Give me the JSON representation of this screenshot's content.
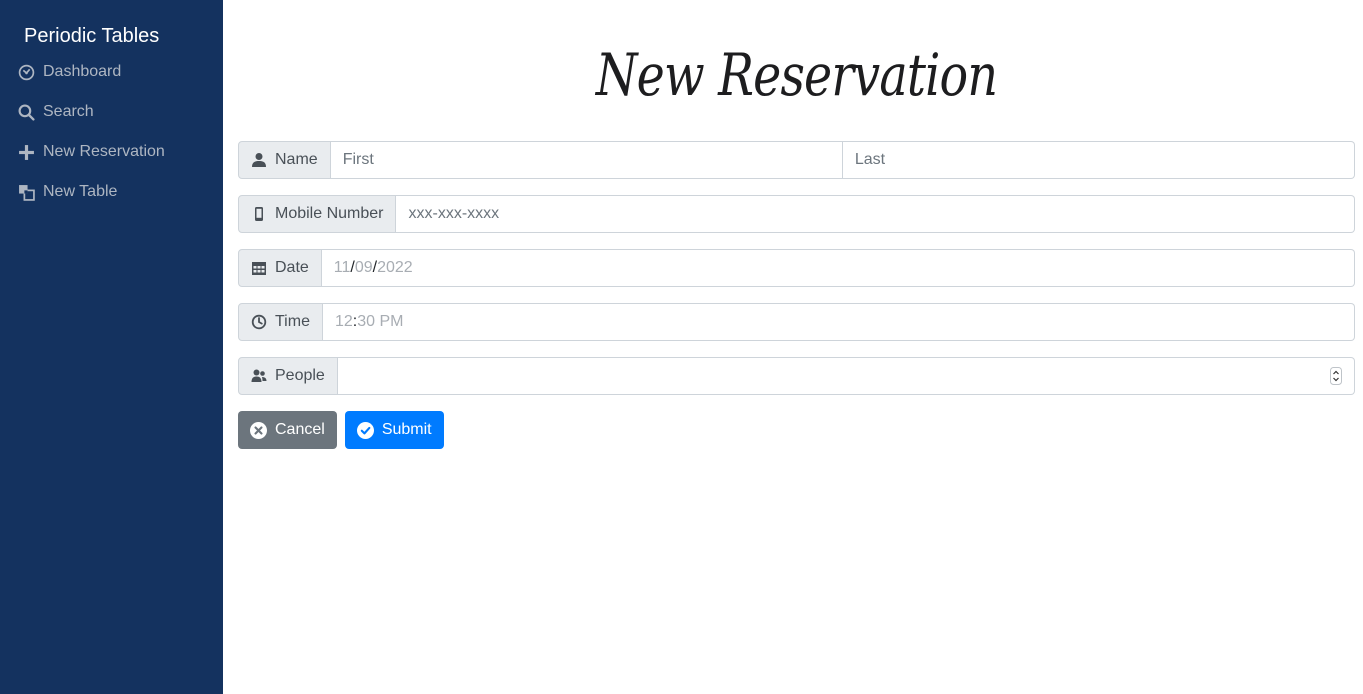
{
  "sidebar": {
    "brand": "Periodic Tables",
    "items": [
      {
        "label": "Dashboard",
        "icon": "dashboard-icon"
      },
      {
        "label": "Search",
        "icon": "search-icon"
      },
      {
        "label": "New Reservation",
        "icon": "plus-icon"
      },
      {
        "label": "New Table",
        "icon": "tables-icon"
      }
    ]
  },
  "page": {
    "title": "New Reservation"
  },
  "form": {
    "name": {
      "label": "Name",
      "first_placeholder": "First",
      "last_placeholder": "Last"
    },
    "mobile": {
      "label": "Mobile Number",
      "placeholder": "xxx-xxx-xxxx"
    },
    "date": {
      "label": "Date",
      "month": "11",
      "day": "09",
      "year": "2022",
      "separator": "/"
    },
    "time": {
      "label": "Time",
      "hour": "12",
      "separator": ":",
      "rest": "30 PM"
    },
    "people": {
      "label": "People",
      "value": ""
    }
  },
  "buttons": {
    "cancel": "Cancel",
    "submit": "Submit"
  },
  "colors": {
    "sidebar_bg": "#14325f",
    "primary": "#007bff",
    "secondary": "#6c757d"
  }
}
